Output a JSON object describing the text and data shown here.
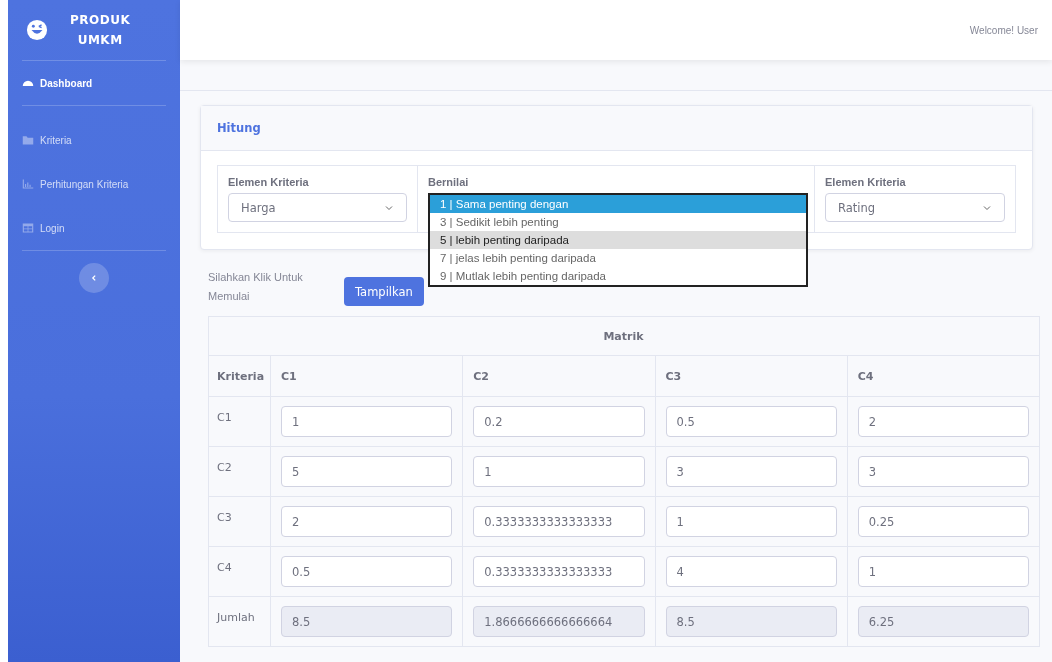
{
  "sidebar": {
    "brand": [
      "PRODUK",
      "UMKM"
    ],
    "items": [
      {
        "label": "Dashboard",
        "kind": "gauge",
        "selected": true
      },
      {
        "label": "Kriteria",
        "kind": "folder",
        "selected": false
      },
      {
        "label": "Perhitungan Kriteria",
        "kind": "chart",
        "selected": false
      },
      {
        "label": "Login",
        "kind": "table",
        "selected": false
      }
    ]
  },
  "topbar": {
    "welcome": "Welcome! User"
  },
  "card": {
    "title": "Hitung",
    "fields": [
      {
        "label": "Elemen Kriteria",
        "kind": "select",
        "value": "Harga"
      },
      {
        "label": "Bernilai",
        "kind": "list"
      },
      {
        "label": "Elemen Kriteria",
        "kind": "select",
        "value": "Rating"
      }
    ],
    "options": [
      {
        "text": "1 | Sama penting dengan",
        "selected": true,
        "highlighted": false
      },
      {
        "text": "3 | Sedikit lebih penting",
        "selected": false,
        "highlighted": false
      },
      {
        "text": "5 | lebih penting daripada",
        "selected": false,
        "highlighted": true
      },
      {
        "text": "7 | jelas lebih penting daripada",
        "selected": false,
        "highlighted": false
      },
      {
        "text": "9 | Mutlak lebih penting daripada",
        "selected": false,
        "highlighted": false
      }
    ]
  },
  "prompt": "Silahkan Klik Untuk Memulai",
  "button": "Tampilkan",
  "table": {
    "title": "Matrik",
    "columns": [
      "Kriteria",
      "C1",
      "C2",
      "C3",
      "C4"
    ],
    "rows": [
      {
        "kind": "input",
        "cells": [
          "C1",
          "1",
          "0.2",
          "0.5",
          "2"
        ]
      },
      {
        "kind": "input",
        "cells": [
          "C2",
          "5",
          "1",
          "3",
          "3"
        ]
      },
      {
        "kind": "input",
        "cells": [
          "C3",
          "2",
          "0.3333333333333333",
          "1",
          "0.25"
        ]
      },
      {
        "kind": "input",
        "cells": [
          "C4",
          "0.5",
          "0.3333333333333333",
          "4",
          "1"
        ]
      },
      {
        "kind": "readonly",
        "cells": [
          "Jumlah",
          "8.5",
          "1.8666666666666664",
          "8.5",
          "6.25"
        ]
      }
    ]
  }
}
